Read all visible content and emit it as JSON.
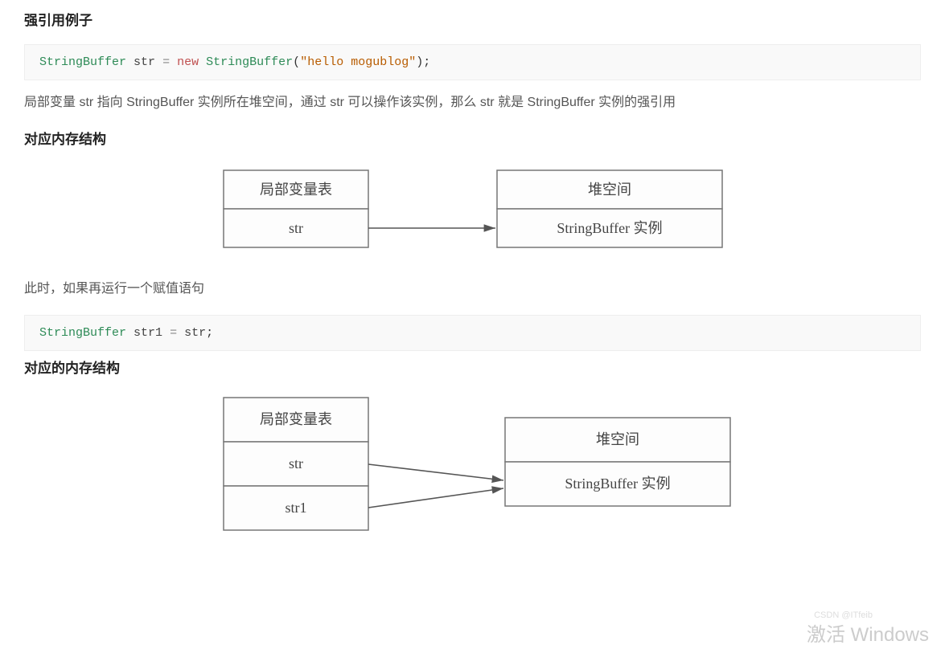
{
  "headings": {
    "h1": "强引用例子",
    "h2": "对应内存结构",
    "h3": "对应的内存结构"
  },
  "code1": {
    "type1": "StringBuffer",
    "var1": "str",
    "eq": "=",
    "kw": "new",
    "type2": "StringBuffer",
    "str": "\"hello mogublog\"",
    "semi": ";",
    "paren_open": "(",
    "paren_close": ")"
  },
  "para1": "局部变量 str 指向 StringBuffer 实例所在堆空间，通过 str 可以操作该实例，那么 str 就是 StringBuffer 实例的强引用",
  "para2": "此时，如果再运行一个赋值语句",
  "code2": {
    "type1": "StringBuffer",
    "var1": "str1",
    "eq": "=",
    "var2": "str",
    "semi": ";"
  },
  "diagram1": {
    "left_header": "局部变量表",
    "left_row": "str",
    "right_header": "堆空间",
    "right_row": "StringBuffer 实例"
  },
  "diagram2": {
    "left_header": "局部变量表",
    "left_row1": "str",
    "left_row2": "str1",
    "right_header": "堆空间",
    "right_row": "StringBuffer 实例"
  },
  "watermark": "激活 Windows",
  "csdn": "CSDN @ITfeib"
}
